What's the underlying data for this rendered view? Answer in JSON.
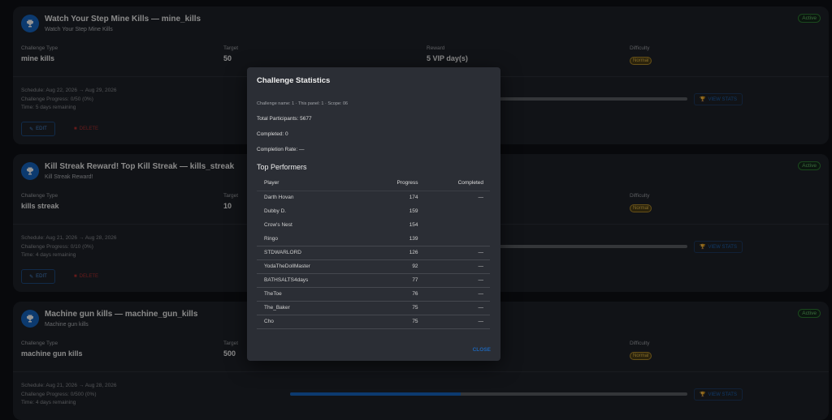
{
  "labels": {
    "challenge_type": "Challenge Type",
    "target": "Target",
    "reward": "Reward",
    "difficulty": "Difficulty",
    "view_stats": "VIEW STATS",
    "edit": "EDIT",
    "delete": "DELETE"
  },
  "cards": [
    {
      "title": "Watch Your Step Mine Kills — mine_kills",
      "subtitle": "Watch Your Step Mine Kills",
      "status": "Active",
      "challenge_type": "mine kills",
      "target": "50",
      "reward": "5 VIP day(s)",
      "difficulty": "Normal",
      "schedule": "Schedule: Aug 22, 2026 → Aug 29, 2026",
      "progress_text": "Challenge Progress: 0/50 (0%)",
      "time": "Time: 5 days remaining",
      "progress": 0
    },
    {
      "title": "Kill Streak Reward! Top Kill Streak — kills_streak",
      "subtitle": "Kill Streak Reward!",
      "status": "Active",
      "challenge_type": "kills streak",
      "target": "10",
      "difficulty": "Normal",
      "schedule": "Schedule: Aug 21, 2026 → Aug 28, 2026",
      "progress_text": "Challenge Progress: 0/10 (0%)",
      "time": "Time: 4 days remaining",
      "progress": 0
    },
    {
      "title": "Machine gun kills — machine_gun_kills",
      "subtitle": "Machine gun kills",
      "status": "Active",
      "challenge_type": "machine gun kills",
      "target": "500",
      "difficulty": "Normal",
      "schedule": "Schedule: Aug 21, 2026 → Aug 28, 2026",
      "progress_text": "Challenge Progress: 0/500 (0%)",
      "time": "Time: 4 days remaining",
      "progress": 0.43
    }
  ],
  "modal": {
    "title": "Challenge Statistics",
    "info": "Challenge name: 1 · This panel: 1 · Scope: 06",
    "total_participants": "Total Participants: 5677",
    "completed": "Completed: 0",
    "completion_rate": "Completion Rate: —",
    "top_performers": "Top Performers",
    "columns": [
      "Player",
      "Progress",
      "Completed"
    ],
    "rows": [
      {
        "player": "Darth Hovan",
        "progress": "174",
        "completed": "—"
      },
      {
        "player": "Dubby D.",
        "progress": "159",
        "completed": ""
      },
      {
        "player": "Crow's Nest",
        "progress": "154",
        "completed": ""
      },
      {
        "player": "Ringo",
        "progress": "139",
        "completed": ""
      },
      {
        "player": "STDWARLORD",
        "progress": "126",
        "completed": "—"
      },
      {
        "player": "YodaTheDollMaster",
        "progress": "92",
        "completed": "—"
      },
      {
        "player": "BATHSALTS4days",
        "progress": "77",
        "completed": "—"
      },
      {
        "player": "TheToe",
        "progress": "76",
        "completed": "—"
      },
      {
        "player": "The_Baker",
        "progress": "75",
        "completed": "—"
      },
      {
        "player": "Cho",
        "progress": "75",
        "completed": "—"
      }
    ],
    "close": "CLOSE"
  }
}
